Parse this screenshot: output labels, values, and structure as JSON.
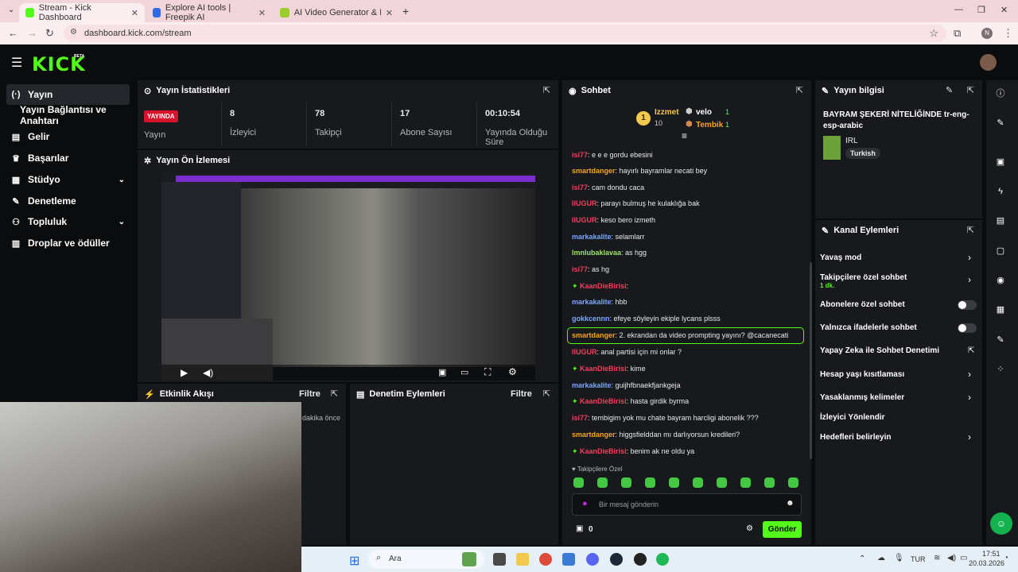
{
  "browser": {
    "tabs": [
      {
        "title": "Stream - Kick Dashboard"
      },
      {
        "title": "Explore AI tools | Freepik AI"
      },
      {
        "title": "AI Video Generator & Image Ge"
      }
    ],
    "url": "dashboard.kick.com/stream",
    "profile_initial": "N"
  },
  "brand": {
    "logo": "KICK",
    "badge": "BETA",
    "accent": "#53fc18"
  },
  "sidebar": {
    "items": [
      {
        "label": "Yayın",
        "icon": "broadcast-icon"
      },
      {
        "label": "Yayın Bağlantısı ve Anahtarı",
        "icon": ""
      },
      {
        "label": "Gelir",
        "icon": "dollar-icon"
      },
      {
        "label": "Başarılar",
        "icon": "trophy-icon"
      },
      {
        "label": "Stüdyo",
        "icon": "studio-icon"
      },
      {
        "label": "Denetleme",
        "icon": "wrench-icon"
      },
      {
        "label": "Topluluk",
        "icon": "people-icon"
      },
      {
        "label": "Droplar ve ödüller",
        "icon": "gift-icon"
      }
    ]
  },
  "stats": {
    "title": "Yayın İstatistikleri",
    "live_badge": "YAYINDA",
    "live_label": "Yayın",
    "viewers": "8",
    "viewers_label": "İzleyici",
    "followers": "78",
    "followers_label": "Takipçi",
    "subs": "17",
    "subs_label": "Abone Sayısı",
    "uptime": "00:10:54",
    "uptime_label": "Yayında Olduğu Süre"
  },
  "preview": {
    "title": "Yayın Ön İzlemesi"
  },
  "activity": {
    "title": "Etkinlik Akışı",
    "filter": "Filtre",
    "time": "dakika önce"
  },
  "moderation": {
    "title": "Denetim Eylemleri",
    "filter": "Filtre"
  },
  "chat": {
    "title": "Sohbet",
    "leaderboard": {
      "rank1": {
        "rank": "1",
        "name": "Izzmet",
        "score": "10"
      },
      "rank2": {
        "name": "velo",
        "score": "1"
      },
      "rank3": {
        "name": "Tembik",
        "score": "1"
      }
    },
    "messages": [
      {
        "user": "isi77",
        "text": ": e e e gordu ebesini",
        "color": "#f43f5e"
      },
      {
        "user": "smartdanger",
        "text": ": hayırlı bayramlar necati bey",
        "color": "#f5a623"
      },
      {
        "user": "isi77",
        "text": ": cam dondu caca",
        "color": "#f43f5e"
      },
      {
        "user": "IIUGUR",
        "text": ": parayı bulmuş he kulaklığa bak",
        "color": "#f43f5e"
      },
      {
        "user": "IIUGUR",
        "text": ": keso bero izmeth",
        "color": "#f43f5e"
      },
      {
        "user": "markakalite",
        "text": ": selamlarr",
        "color": "#7aa7ff"
      },
      {
        "user": "lmnlubaklavaa",
        "text": ": as hgg",
        "color": "#9ae66e"
      },
      {
        "user": "isi77",
        "text": ": as hg",
        "color": "#f43f5e"
      },
      {
        "user": "KaanDieBirisi",
        "text": ":",
        "color": "#f43f5e"
      },
      {
        "user": "markakalite",
        "text": ": hbb",
        "color": "#7aa7ff"
      },
      {
        "user": "gokkcennn",
        "text": ": efeye söyleyin ekiple lycans plsss",
        "color": "#7aa7ff"
      },
      {
        "user": "smartdanger",
        "text": ": 2. ekrandan da video prompting yayını? @cacanecati",
        "color": "#f5a623"
      },
      {
        "user": "IIUGUR",
        "text": ": anal partisi için mi onlar ?",
        "color": "#f43f5e"
      },
      {
        "user": "KaanDieBirisi",
        "text": ": kime",
        "color": "#f43f5e"
      },
      {
        "user": "markakalite",
        "text": ": guijhfbnaekfjankgeja",
        "color": "#7aa7ff"
      },
      {
        "user": "KaanDieBirisi",
        "text": ": hasta girdik byrma",
        "color": "#f43f5e"
      },
      {
        "user": "isi77",
        "text": ": tembigim yok mu chate bayram harcligi abonelik ???",
        "color": "#f43f5e"
      },
      {
        "user": "smartdanger",
        "text": ": higgsfielddan mı darlıyorsun kredileri?",
        "color": "#f5a623"
      },
      {
        "user": "KaanDieBirisi",
        "text": ": benim ak ne oldu ya",
        "color": "#f43f5e"
      }
    ],
    "emotes_label": "Takipçilere Özel",
    "input_placeholder": "Bir mesaj gönderin",
    "points": "0",
    "send": "Gönder"
  },
  "stream_info": {
    "title": "Yayın bilgisi",
    "stream_title": "BAYRAM ŞEKERİ NİTELİĞİNDE tr-eng-esp-arabic",
    "category": "IRL",
    "tag": "Turkish"
  },
  "channel_actions": {
    "title": "Kanal Eylemleri",
    "items": [
      {
        "label": "Yavaş mod",
        "control": "chevron"
      },
      {
        "label": "Takipçilere özel sohbet",
        "sub": "1 dk.",
        "control": "chevron"
      },
      {
        "label": "Abonelere özel sohbet",
        "control": "toggle"
      },
      {
        "label": "Yalnızca ifadelerle sohbet",
        "control": "toggle"
      },
      {
        "label": "Yapay Zeka ile Sohbet Denetimi",
        "control": "external"
      },
      {
        "label": "Hesap yaşı kısıtlaması",
        "control": "chevron"
      },
      {
        "label": "Yasaklanmış kelimeler",
        "control": "chevron"
      },
      {
        "label": "İzleyici Yönlendir",
        "control": "none"
      },
      {
        "label": "Hedefleri belirleyin",
        "control": "chevron"
      }
    ]
  },
  "taskbar": {
    "search": "Ara",
    "lang": "TUR",
    "time": "17:51",
    "date": "20.03.2026"
  }
}
